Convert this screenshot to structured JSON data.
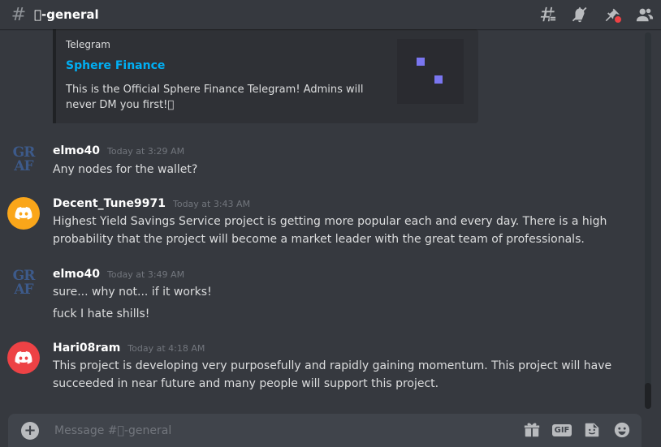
{
  "header": {
    "channel_name": "\u0000-general",
    "icons": [
      "threads-icon",
      "mute-bell-icon",
      "pin-icon",
      "members-icon"
    ]
  },
  "embed": {
    "provider": "Telegram",
    "title": "Sphere Finance",
    "description": "This is the Official Sphere Finance Telegram! Admins will never DM you first!\u0000",
    "title_color": "#00aff4"
  },
  "messages": [
    {
      "username": "elmo40",
      "timestamp": "Today at 3:29 AM",
      "avatar": "graf",
      "lines": [
        "Any nodes for the wallet?"
      ]
    },
    {
      "username": "Decent_Tune9971",
      "timestamp": "Today at 3:43 AM",
      "avatar": "discord",
      "avatar_color": "#faa61a",
      "lines": [
        "Highest Yield Savings Service project is getting more popular each and every day. There is a high",
        "probability that the project will become a market leader with the great team of professionals."
      ]
    },
    {
      "username": "elmo40",
      "timestamp": "Today at 3:49 AM",
      "avatar": "graf",
      "lines": [
        "sure... why not... if it works!",
        "fuck I hate shills!"
      ]
    },
    {
      "username": "Hari08ram",
      "timestamp": "Today at 4:18 AM",
      "avatar": "discord",
      "avatar_color": "#ed4245",
      "lines": [
        "This project is developing very purposefully and rapidly gaining momentum. This project will have",
        "succeeded in near future and many people will support this project."
      ]
    }
  ],
  "graf_avatar": {
    "top": "GR",
    "bottom": "AF"
  },
  "composer": {
    "placeholder": "Message #\u0000-general",
    "gif_label": "GIF",
    "icons": [
      "gift-icon",
      "gif-icon",
      "sticker-icon",
      "emoji-icon"
    ]
  }
}
